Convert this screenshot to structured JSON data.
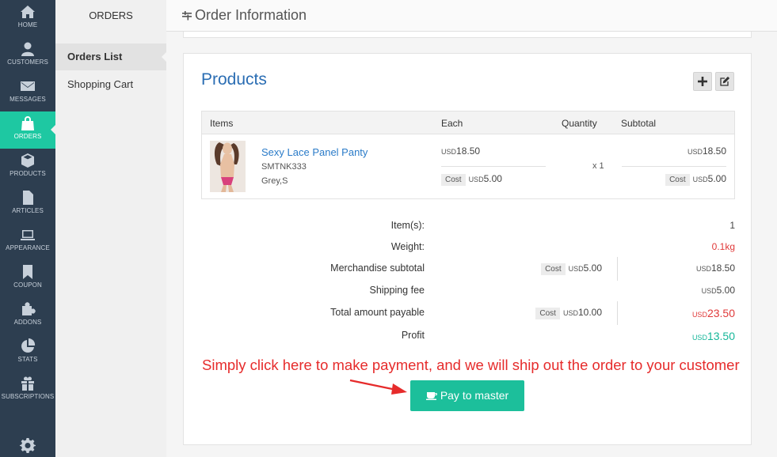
{
  "nav": {
    "items": [
      {
        "label": "HOME",
        "icon": "home-icon"
      },
      {
        "label": "CUSTOMERS",
        "icon": "user-icon"
      },
      {
        "label": "MESSAGES",
        "icon": "envelope-icon"
      },
      {
        "label": "ORDERS",
        "icon": "shopping-bag-icon",
        "active": true
      },
      {
        "label": "PRODUCTS",
        "icon": "cube-icon"
      },
      {
        "label": "ARTICLES",
        "icon": "file-icon"
      },
      {
        "label": "APPEARANCE",
        "icon": "laptop-icon"
      },
      {
        "label": "COUPON",
        "icon": "bookmark-icon"
      },
      {
        "label": "ADDONS",
        "icon": "puzzle-icon"
      },
      {
        "label": "STATS",
        "icon": "pie-chart-icon"
      },
      {
        "label": "SUBSCRIPTIONS",
        "icon": "gift-icon"
      }
    ],
    "settings_icon": "gear-icon"
  },
  "subnav": {
    "title": "ORDERS",
    "items": [
      {
        "label": "Orders List",
        "active": true
      },
      {
        "label": "Shopping Cart"
      }
    ]
  },
  "header": {
    "title": "Order Information"
  },
  "products": {
    "title": "Products",
    "columns": {
      "items": "Items",
      "each": "Each",
      "quantity": "Quantity",
      "subtotal": "Subtotal"
    },
    "rows": [
      {
        "name": "Sexy Lace Panel Panty",
        "sku": "SMTNK333",
        "variant": "Grey,S",
        "currency": "USD",
        "price": "18.50",
        "cost_label": "Cost",
        "cost": "5.00",
        "quantity": "x 1",
        "subtotal": "18.50",
        "subtotal_cost": "5.00"
      }
    ]
  },
  "summary": {
    "currency": "USD",
    "cost_label": "Cost",
    "items_label": "Item(s):",
    "items_value": "1",
    "weight_label": "Weight:",
    "weight_value": "0.1kg",
    "merch_label": "Merchandise subtotal",
    "merch_cost": "5.00",
    "merch_value": "18.50",
    "shipping_label": "Shipping fee",
    "shipping_value": "5.00",
    "total_label": "Total amount payable",
    "total_cost": "10.00",
    "total_value": "23.50",
    "profit_label": "Profit",
    "profit_value": "13.50"
  },
  "annotation": "Simply click here to make payment, and we will ship out the order to your customer",
  "pay_button": "Pay to master",
  "colors": {
    "accent": "#1cbf9b",
    "sidebar": "#2d3e50",
    "link": "#2a6db3",
    "alert": "#e62b2b"
  }
}
